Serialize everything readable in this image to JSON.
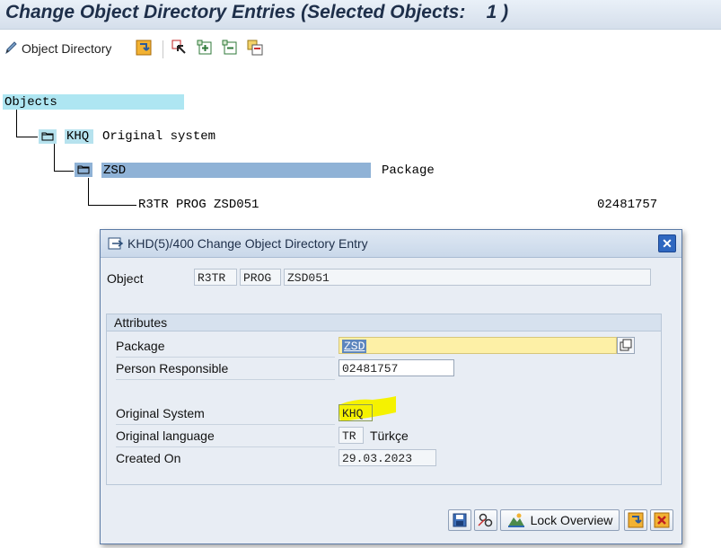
{
  "title": "Change Object Directory Entries (Selected Objects:    1 )",
  "toolbar": {
    "object_directory_label": "Object Directory",
    "icons": [
      "pencil-icon",
      "execute-icon",
      "select-icon",
      "expand-icon",
      "collapse-icon",
      "copy-icon"
    ]
  },
  "tree": {
    "root_label": "Objects",
    "system_code": "KHQ",
    "system_label": "Original system",
    "package_code": "ZSD",
    "package_label": "Package",
    "object_text": "R3TR PROG ZSD051",
    "object_user": "02481757"
  },
  "dialog": {
    "title": "KHD(5)/400 Change Object Directory Entry",
    "object_label": "Object",
    "object_pgmid": "R3TR",
    "object_type": "PROG",
    "object_name": "ZSD051",
    "attributes_title": "Attributes",
    "package_label": "Package",
    "package_value": "ZSD",
    "person_label": "Person Responsible",
    "person_value": "02481757",
    "orig_system_label": "Original System",
    "orig_system_value": "KHQ",
    "orig_lang_label": "Original language",
    "orig_lang_code": "TR",
    "orig_lang_name": "Türkçe",
    "created_label": "Created On",
    "created_value": "29.03.2023",
    "buttons": {
      "lock_overview": "Lock Overview"
    }
  },
  "colors": {
    "title_text": "#1e2f4a",
    "highlight_yellow": "#f5f200",
    "package_field": "#fdf0a6",
    "objects_highlight": "#aee6f2"
  }
}
